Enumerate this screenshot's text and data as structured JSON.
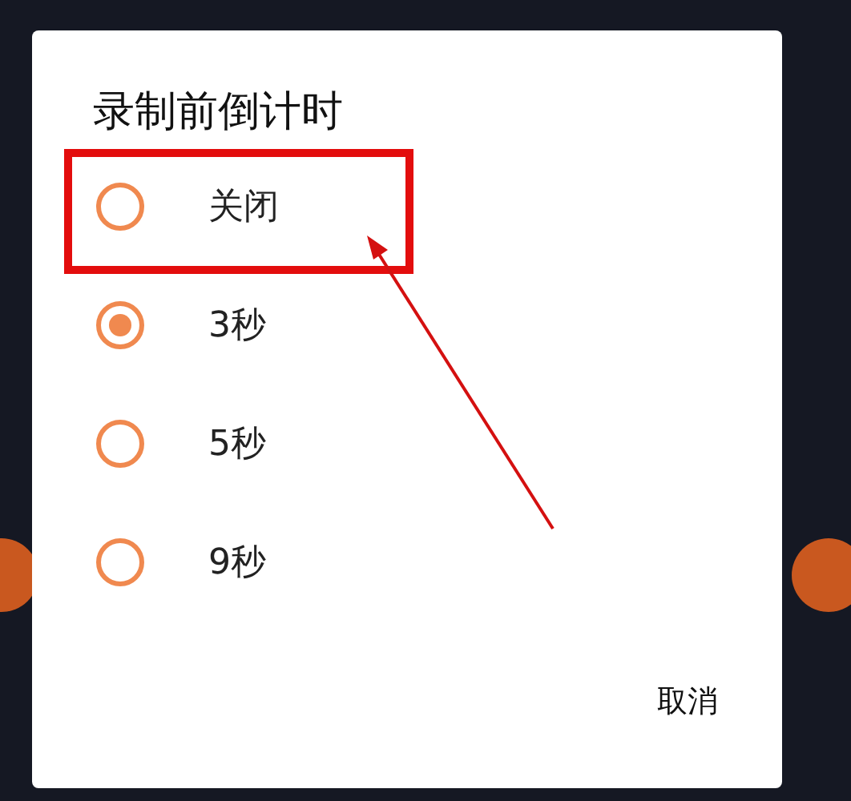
{
  "dialog": {
    "title": "录制前倒计时",
    "options": [
      {
        "label": "关闭",
        "selected": false,
        "highlighted": true
      },
      {
        "label": "3秒",
        "selected": true,
        "highlighted": false
      },
      {
        "label": "5秒",
        "selected": false,
        "highlighted": false
      },
      {
        "label": "9秒",
        "selected": false,
        "highlighted": false
      }
    ],
    "cancel": "取消"
  }
}
